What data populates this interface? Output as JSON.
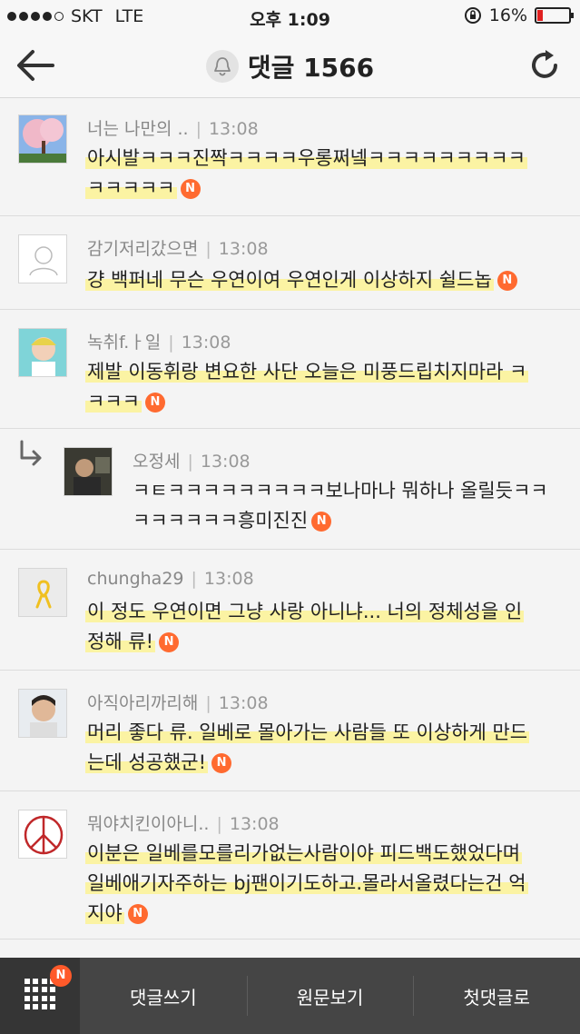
{
  "status_bar": {
    "carrier": "SKT",
    "network": "LTE",
    "time": "오후 1:09",
    "battery": "16%",
    "battery_level": 0.16
  },
  "header": {
    "title": "댓글 1566"
  },
  "comments": [
    {
      "user": "너는 나만의 ..",
      "time": "13:08",
      "lines": [
        "아시발ㅋㅋㅋ진짝ㅋㅋㅋㅋ우롱쩌넼ㅋㅋㅋㅋㅋㅋㅋㅋㅋ",
        "ㅋㅋㅋㅋㅋ"
      ],
      "badge": "N"
    },
    {
      "user": "감기저리갔으면",
      "time": "13:08",
      "lines": [
        "걍 백퍼네 무슨 우연이여 우연인게 이상하지 쉴드놉"
      ],
      "badge": "N"
    },
    {
      "user": "녹취f.ㅏ일",
      "time": "13:08",
      "lines": [
        "제발 이동휘랑 변요한 사단 오늘은 미풍드립치지마라 ㅋ",
        "ㅋㅋㅋ"
      ],
      "badge": "N"
    },
    {
      "user": "오정세",
      "time": "13:08",
      "lines": [
        "ㅋㅌㅋㅋㅋㅋㅋㅋㅋㅋㅋ보나마나 뭐하나 올릴듯ㅋㅋ",
        "ㅋㅋㅋㅋㅋㅋ흥미진진"
      ],
      "badge": "N"
    },
    {
      "user": "chungha29",
      "time": "13:08",
      "lines": [
        "이 정도 우연이면 그냥 사랑 아니냐... 너의 정체성을 인",
        "정해 류!"
      ],
      "badge": "N"
    },
    {
      "user": "아직아리까리해",
      "time": "13:08",
      "lines": [
        "머리 좋다 류. 일베로 몰아가는 사람들 또 이상하게 만드",
        "는데 성공했군!"
      ],
      "badge": "N"
    },
    {
      "user": "뭐야치킨이아니..",
      "time": "13:08",
      "lines": [
        "이분은 일베를모를리가없는사람이야 피드백도했었다며",
        "일베애기자주하는 bj팬이기도하고.몰라서올렸다는건 억",
        "지야"
      ],
      "badge": "N"
    }
  ],
  "bottom_bar": {
    "menu_badge": "N",
    "write": "댓글쓰기",
    "original": "원문보기",
    "first": "첫댓글로"
  }
}
